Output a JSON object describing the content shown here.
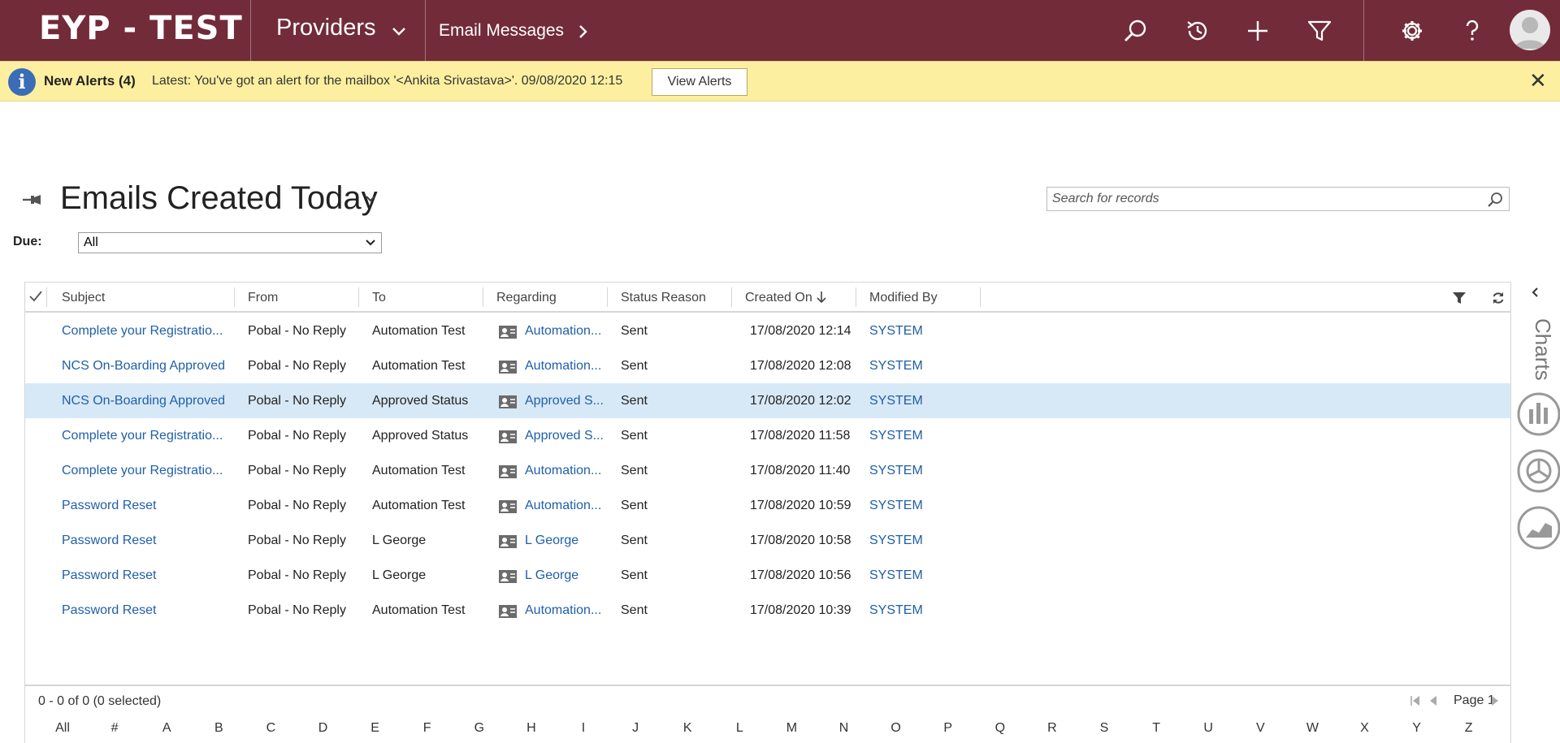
{
  "app": {
    "brand": "EYP - TEST",
    "area": "Providers",
    "breadcrumb": "Email Messages",
    "nav_color": "#722b39"
  },
  "alert": {
    "title": "New Alerts (4)",
    "message": "Latest: You've got an alert for the mailbox '<Ankita Srivastava>'. 09/08/2020 12:15",
    "button": "View Alerts",
    "close": "✕"
  },
  "view": {
    "title": "Emails Created Today",
    "search_placeholder": "Search for records",
    "due_label": "Due:",
    "due_value": "All"
  },
  "grid": {
    "columns": [
      "Subject",
      "From",
      "To",
      "Regarding",
      "Status Reason",
      "Created On",
      "Modified By"
    ],
    "rows": [
      {
        "subject": "Complete your Registratio...",
        "from": "Pobal - No Reply",
        "to": "Automation Test",
        "regarding": "Automation...",
        "status": "Sent",
        "created": "17/08/2020 12:14",
        "modified": "SYSTEM",
        "selected": false
      },
      {
        "subject": "NCS On-Boarding Approved",
        "from": "Pobal - No Reply",
        "to": "Automation Test",
        "regarding": "Automation...",
        "status": "Sent",
        "created": "17/08/2020 12:08",
        "modified": "SYSTEM",
        "selected": false
      },
      {
        "subject": "NCS On-Boarding Approved",
        "from": "Pobal - No Reply",
        "to": "Approved Status",
        "regarding": "Approved S...",
        "status": "Sent",
        "created": "17/08/2020 12:02",
        "modified": "SYSTEM",
        "selected": true
      },
      {
        "subject": "Complete your Registratio...",
        "from": "Pobal - No Reply",
        "to": "Approved Status",
        "regarding": "Approved S...",
        "status": "Sent",
        "created": "17/08/2020 11:58",
        "modified": "SYSTEM",
        "selected": false
      },
      {
        "subject": "Complete your Registratio...",
        "from": "Pobal - No Reply",
        "to": "Automation Test",
        "regarding": "Automation...",
        "status": "Sent",
        "created": "17/08/2020 11:40",
        "modified": "SYSTEM",
        "selected": false
      },
      {
        "subject": "Password Reset",
        "from": "Pobal - No Reply",
        "to": "Automation Test",
        "regarding": "Automation...",
        "status": "Sent",
        "created": "17/08/2020 10:59",
        "modified": "SYSTEM",
        "selected": false
      },
      {
        "subject": "Password Reset",
        "from": "Pobal - No Reply",
        "to": "L George",
        "regarding": "L George",
        "status": "Sent",
        "created": "17/08/2020 10:58",
        "modified": "SYSTEM",
        "selected": false
      },
      {
        "subject": "Password Reset",
        "from": "Pobal - No Reply",
        "to": "L George",
        "regarding": "L George",
        "status": "Sent",
        "created": "17/08/2020 10:56",
        "modified": "SYSTEM",
        "selected": false
      },
      {
        "subject": "Password Reset",
        "from": "Pobal - No Reply",
        "to": "Automation Test",
        "regarding": "Automation...",
        "status": "Sent",
        "created": "17/08/2020 10:39",
        "modified": "SYSTEM",
        "selected": false
      }
    ],
    "footer_count": "0 - 0 of 0 (0 selected)",
    "page_label": "Page 1",
    "jump_letters": [
      "All",
      "#",
      "A",
      "B",
      "C",
      "D",
      "E",
      "F",
      "G",
      "H",
      "I",
      "J",
      "K",
      "L",
      "M",
      "N",
      "O",
      "P",
      "Q",
      "R",
      "S",
      "T",
      "U",
      "V",
      "W",
      "X",
      "Y",
      "Z"
    ]
  },
  "side_panel": {
    "label": "Charts"
  },
  "colors": {
    "alert_bg": "#fcf0a0",
    "link": "#1f5fa8",
    "selected_row": "#d7e9f7"
  }
}
